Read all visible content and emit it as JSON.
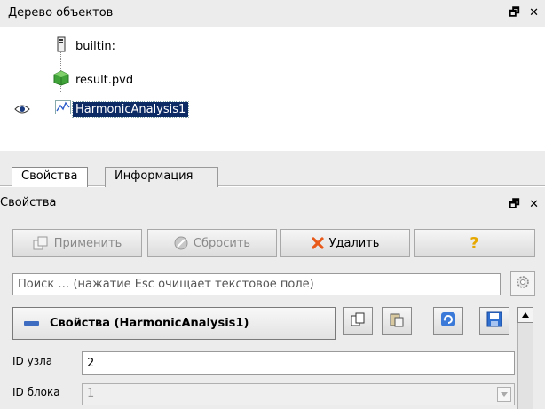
{
  "pipeline_panel": {
    "title": "Дерево объектов",
    "controls": "🗗 ✕",
    "items": [
      {
        "label": "builtin:",
        "icon": "server-icon"
      },
      {
        "label": "result.pvd",
        "icon": "green-cube-icon"
      },
      {
        "label": "HarmonicAnalysis1",
        "icon": "line-chart-icon",
        "selected": true,
        "visible": true
      }
    ]
  },
  "tabs": [
    {
      "label": "Свойства",
      "active": true
    },
    {
      "label": "Информация",
      "active": false
    }
  ],
  "properties_panel": {
    "title": "Свойства",
    "controls": "🗗 ✕",
    "buttons": {
      "apply": "Применить",
      "reset": "Сбросить",
      "delete": "Удалить",
      "help": "?"
    },
    "search": {
      "placeholder": "Поиск … (нажатие Esc очищает текстовое поле)",
      "value": ""
    },
    "section_title": "Свойства (HarmonicAnalysis1)",
    "fields": {
      "node_id_label": "ID узла",
      "node_id_value": "2",
      "block_id_label": "ID блока",
      "block_id_value": "1"
    }
  },
  "colors": {
    "selection": "#0c2a64",
    "panel_bg": "#ececec",
    "help_icon": "#e6a800",
    "delete_icon": "#e85a1a",
    "section_dash": "#3d6cc0"
  }
}
